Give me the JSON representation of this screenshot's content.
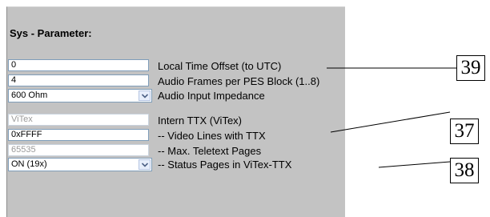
{
  "section": {
    "title": "Sys - Parameter:"
  },
  "rows": [
    {
      "type": "input",
      "value": "0",
      "label": "Local Time Offset (to UTC)",
      "disabled": false
    },
    {
      "type": "input",
      "value": "4",
      "label": "Audio Frames per PES Block (1..8)",
      "disabled": false
    },
    {
      "type": "select",
      "value": "600 Ohm",
      "label": "Audio Input Impedance"
    },
    {
      "type": "input",
      "value": "ViTex",
      "label": "Intern TTX (ViTex)",
      "disabled": true
    },
    {
      "type": "input",
      "value": "0xFFFF",
      "label": "-- Video Lines with TTX",
      "disabled": false
    },
    {
      "type": "input",
      "value": "65535",
      "label": "-- Max. Teletext Pages",
      "disabled": true
    },
    {
      "type": "select",
      "value": "ON (19x)",
      "label": "-- Status Pages in ViTex-TTX"
    }
  ],
  "callouts": [
    "39",
    "37",
    "38"
  ],
  "icons": {
    "dropdown": "chevron-down-icon"
  }
}
